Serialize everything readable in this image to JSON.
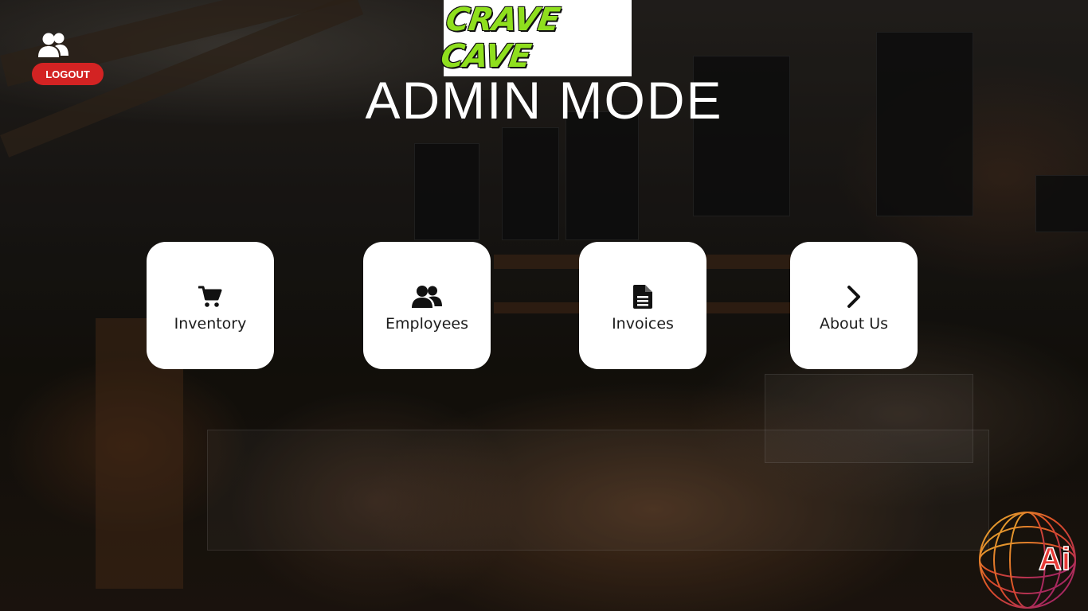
{
  "header": {
    "logo_text": "CRAVE CAVE",
    "title": "ADMIN MODE"
  },
  "account": {
    "user_icon": "users-icon",
    "logout_label": "LOGOUT",
    "logout_color": "#d32323"
  },
  "menu": {
    "items": [
      {
        "label": "Inventory",
        "icon": "shopping-cart-icon"
      },
      {
        "label": "Employees",
        "icon": "users-icon"
      },
      {
        "label": "Invoices",
        "icon": "file-text-icon"
      },
      {
        "label": "About Us",
        "icon": "chevron-right-icon"
      }
    ]
  },
  "branding": {
    "corner_logo_text": "Ai",
    "accent": "#e53935"
  }
}
